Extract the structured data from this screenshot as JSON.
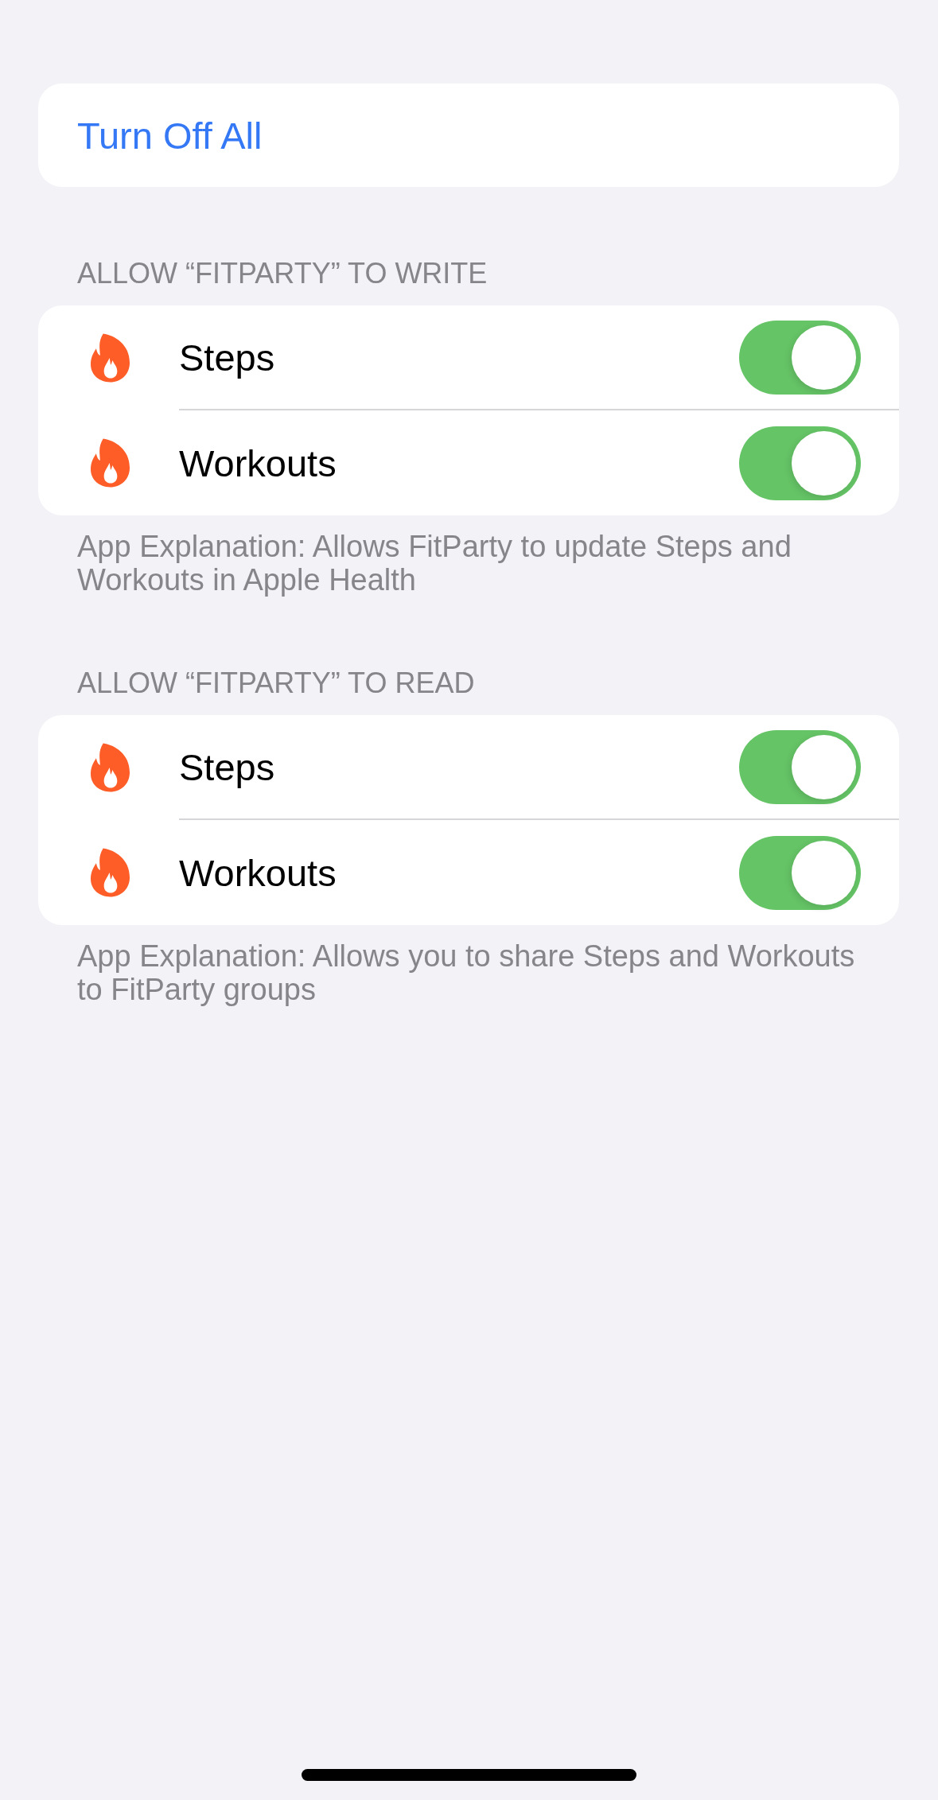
{
  "turn_off_all": {
    "label": "Turn Off All"
  },
  "sections": [
    {
      "header": "ALLOW “FITPARTY” TO WRITE",
      "items": [
        {
          "label": "Steps",
          "on": true
        },
        {
          "label": "Workouts",
          "on": true
        }
      ],
      "footer": "App Explanation: Allows FitParty to update Steps and Workouts in Apple Health"
    },
    {
      "header": "ALLOW “FITPARTY” TO READ",
      "items": [
        {
          "label": "Steps",
          "on": true
        },
        {
          "label": "Workouts",
          "on": true
        }
      ],
      "footer": "App Explanation: Allows you to share Steps and Workouts to FitParty groups"
    }
  ]
}
